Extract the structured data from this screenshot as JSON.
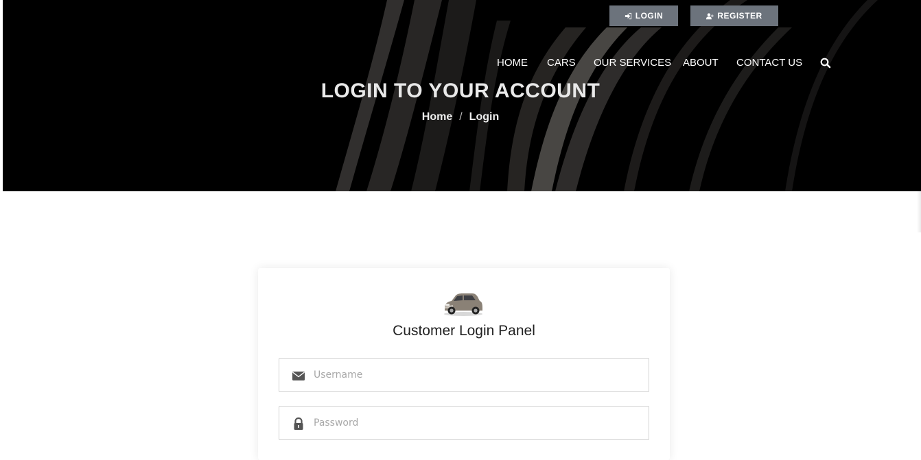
{
  "header": {
    "login_button": "LOGIN",
    "register_button": "REGISTER",
    "nav": [
      "HOME",
      "CARS",
      "OUR SERVICES",
      "ABOUT",
      "CONTACT US"
    ],
    "title": "LOGIN TO YOUR ACCOUNT",
    "breadcrumb": {
      "home": "Home",
      "separator": "/",
      "current": "Login"
    }
  },
  "login_panel": {
    "title": "Customer Login Panel",
    "username_placeholder": "Username",
    "password_placeholder": "Password",
    "username_icon": "envelope-icon",
    "password_icon": "lock-icon"
  },
  "colors": {
    "hero_bg": "#000000",
    "top_button_bg": "#6c737c",
    "text_on_dark": "#ffffff"
  }
}
